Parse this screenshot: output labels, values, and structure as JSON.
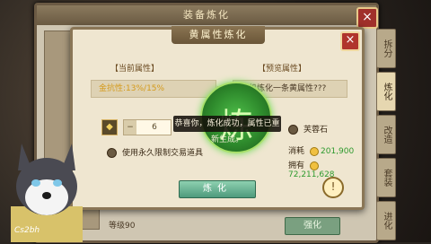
{
  "outer": {
    "title": "装备炼化",
    "tabs": [
      "拆分",
      "炼化",
      "改造",
      "套装",
      "进化"
    ],
    "active_tab_index": 1,
    "bottom_stat": "等级90",
    "bottom_button": "强化"
  },
  "dialog": {
    "title": "黄属性炼化",
    "current_header": "【当前属性】",
    "preview_header": "【预览属性】",
    "current_attr": "金抗性:13%/15%",
    "preview_attr": "随机炼化一条黄属性???",
    "stepper_value": "6",
    "toast": "恭喜你，炼化成功，属性已重新生成。",
    "stone_label": "芙蓉石",
    "trade_option": "使用永久限制交易道具",
    "consume_label": "消耗",
    "consume_value": "201,900",
    "own_label": "拥有",
    "own_value": "72,211,628",
    "refine_button": "炼化",
    "info_symbol": "!",
    "close_symbol": "×"
  },
  "streamer_tag": "Cs2bh"
}
